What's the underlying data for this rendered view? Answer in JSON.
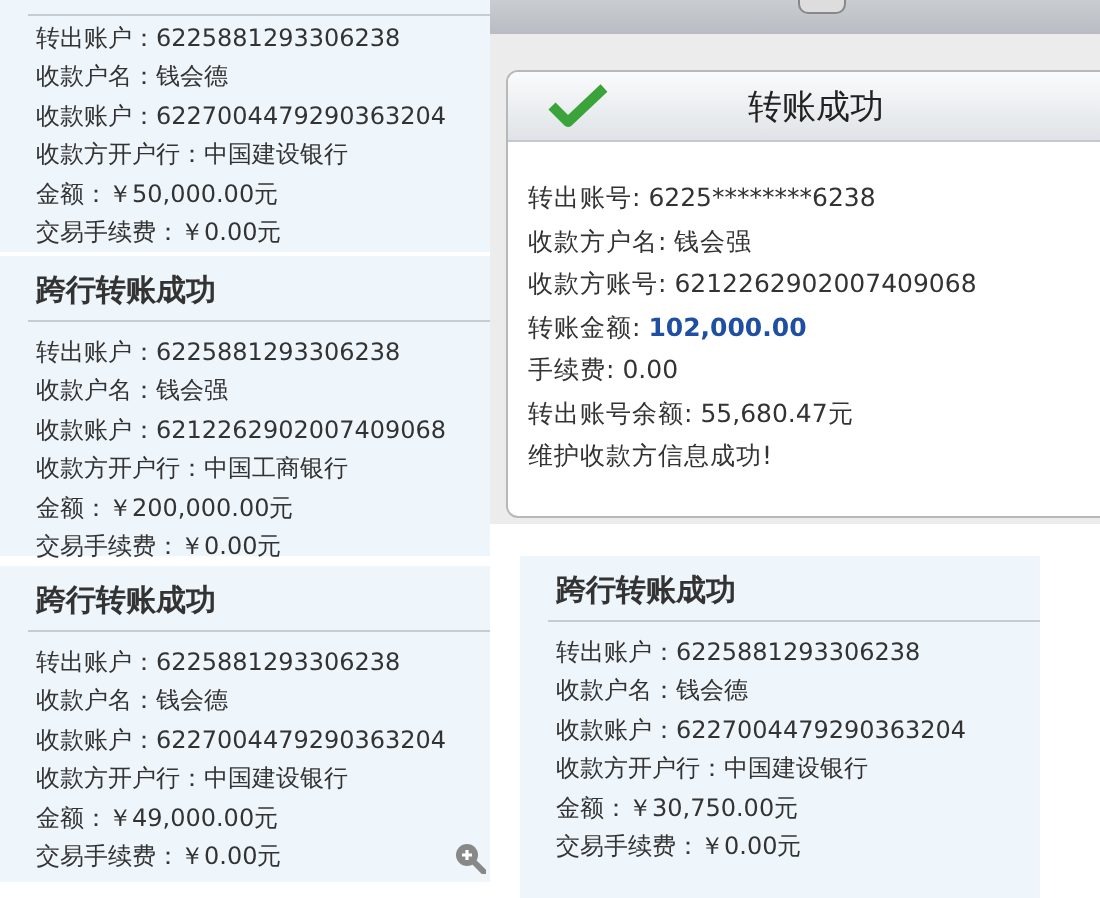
{
  "panels": [
    {
      "kind": "detail",
      "lines": [
        "转出账户：6225881293306238",
        "收款户名：钱会德",
        "收款账户：6227004479290363204",
        "收款方开户行：中国建设银行",
        "金额：￥50,000.00元",
        "交易手续费：￥0.00元"
      ]
    },
    {
      "kind": "confirm",
      "title": "转账成功",
      "fields": [
        {
          "label": "转出账号: ",
          "value": "6225********6238",
          "highlight": false
        },
        {
          "label": "收款方户名: ",
          "value": "钱会强",
          "highlight": false
        },
        {
          "label": "收款方账号: ",
          "value": "6212262902007409068",
          "highlight": false
        },
        {
          "label": "转账金额: ",
          "value": "102,000.00",
          "highlight": true
        },
        {
          "label": "手续费: ",
          "value": "0.00",
          "highlight": false
        },
        {
          "label": "转出账号余额: ",
          "value": "55,680.47元",
          "highlight": false
        }
      ],
      "message": "维护收款方信息成功!"
    },
    {
      "kind": "detail",
      "title": "跨行转账成功",
      "lines": [
        "转出账户：6225881293306238",
        "收款户名：钱会强",
        "收款账户：6212262902007409068",
        "收款方开户行：中国工商银行",
        "金额：￥200,000.00元",
        "交易手续费：￥0.00元"
      ]
    },
    {
      "kind": "detail",
      "title": "跨行转账成功",
      "lines": [
        "转出账户：6225881293306238",
        "收款户名：钱会德",
        "收款账户：6227004479290363204",
        "收款方开户行：中国建设银行",
        "金额：￥49,000.00元",
        "交易手续费：￥0.00元"
      ]
    },
    {
      "kind": "detail",
      "title": "跨行转账成功",
      "lines": [
        "转出账户：6225881293306238",
        "收款户名：钱会德",
        "收款账户：6227004479290363204",
        "收款方开户行：中国建设银行",
        "金额：￥30,750.00元",
        "交易手续费：￥0.00元"
      ]
    }
  ]
}
